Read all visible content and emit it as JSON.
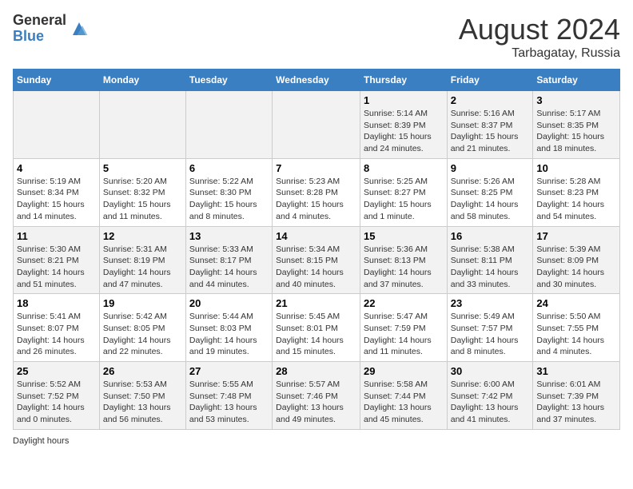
{
  "header": {
    "logo_general": "General",
    "logo_blue": "Blue",
    "month_title": "August 2024",
    "location": "Tarbagatay, Russia"
  },
  "days_of_week": [
    "Sunday",
    "Monday",
    "Tuesday",
    "Wednesday",
    "Thursday",
    "Friday",
    "Saturday"
  ],
  "weeks": [
    [
      {
        "day": "",
        "info": ""
      },
      {
        "day": "",
        "info": ""
      },
      {
        "day": "",
        "info": ""
      },
      {
        "day": "",
        "info": ""
      },
      {
        "day": "1",
        "info": "Sunrise: 5:14 AM\nSunset: 8:39 PM\nDaylight: 15 hours and 24 minutes."
      },
      {
        "day": "2",
        "info": "Sunrise: 5:16 AM\nSunset: 8:37 PM\nDaylight: 15 hours and 21 minutes."
      },
      {
        "day": "3",
        "info": "Sunrise: 5:17 AM\nSunset: 8:35 PM\nDaylight: 15 hours and 18 minutes."
      }
    ],
    [
      {
        "day": "4",
        "info": "Sunrise: 5:19 AM\nSunset: 8:34 PM\nDaylight: 15 hours and 14 minutes."
      },
      {
        "day": "5",
        "info": "Sunrise: 5:20 AM\nSunset: 8:32 PM\nDaylight: 15 hours and 11 minutes."
      },
      {
        "day": "6",
        "info": "Sunrise: 5:22 AM\nSunset: 8:30 PM\nDaylight: 15 hours and 8 minutes."
      },
      {
        "day": "7",
        "info": "Sunrise: 5:23 AM\nSunset: 8:28 PM\nDaylight: 15 hours and 4 minutes."
      },
      {
        "day": "8",
        "info": "Sunrise: 5:25 AM\nSunset: 8:27 PM\nDaylight: 15 hours and 1 minute."
      },
      {
        "day": "9",
        "info": "Sunrise: 5:26 AM\nSunset: 8:25 PM\nDaylight: 14 hours and 58 minutes."
      },
      {
        "day": "10",
        "info": "Sunrise: 5:28 AM\nSunset: 8:23 PM\nDaylight: 14 hours and 54 minutes."
      }
    ],
    [
      {
        "day": "11",
        "info": "Sunrise: 5:30 AM\nSunset: 8:21 PM\nDaylight: 14 hours and 51 minutes."
      },
      {
        "day": "12",
        "info": "Sunrise: 5:31 AM\nSunset: 8:19 PM\nDaylight: 14 hours and 47 minutes."
      },
      {
        "day": "13",
        "info": "Sunrise: 5:33 AM\nSunset: 8:17 PM\nDaylight: 14 hours and 44 minutes."
      },
      {
        "day": "14",
        "info": "Sunrise: 5:34 AM\nSunset: 8:15 PM\nDaylight: 14 hours and 40 minutes."
      },
      {
        "day": "15",
        "info": "Sunrise: 5:36 AM\nSunset: 8:13 PM\nDaylight: 14 hours and 37 minutes."
      },
      {
        "day": "16",
        "info": "Sunrise: 5:38 AM\nSunset: 8:11 PM\nDaylight: 14 hours and 33 minutes."
      },
      {
        "day": "17",
        "info": "Sunrise: 5:39 AM\nSunset: 8:09 PM\nDaylight: 14 hours and 30 minutes."
      }
    ],
    [
      {
        "day": "18",
        "info": "Sunrise: 5:41 AM\nSunset: 8:07 PM\nDaylight: 14 hours and 26 minutes."
      },
      {
        "day": "19",
        "info": "Sunrise: 5:42 AM\nSunset: 8:05 PM\nDaylight: 14 hours and 22 minutes."
      },
      {
        "day": "20",
        "info": "Sunrise: 5:44 AM\nSunset: 8:03 PM\nDaylight: 14 hours and 19 minutes."
      },
      {
        "day": "21",
        "info": "Sunrise: 5:45 AM\nSunset: 8:01 PM\nDaylight: 14 hours and 15 minutes."
      },
      {
        "day": "22",
        "info": "Sunrise: 5:47 AM\nSunset: 7:59 PM\nDaylight: 14 hours and 11 minutes."
      },
      {
        "day": "23",
        "info": "Sunrise: 5:49 AM\nSunset: 7:57 PM\nDaylight: 14 hours and 8 minutes."
      },
      {
        "day": "24",
        "info": "Sunrise: 5:50 AM\nSunset: 7:55 PM\nDaylight: 14 hours and 4 minutes."
      }
    ],
    [
      {
        "day": "25",
        "info": "Sunrise: 5:52 AM\nSunset: 7:52 PM\nDaylight: 14 hours and 0 minutes."
      },
      {
        "day": "26",
        "info": "Sunrise: 5:53 AM\nSunset: 7:50 PM\nDaylight: 13 hours and 56 minutes."
      },
      {
        "day": "27",
        "info": "Sunrise: 5:55 AM\nSunset: 7:48 PM\nDaylight: 13 hours and 53 minutes."
      },
      {
        "day": "28",
        "info": "Sunrise: 5:57 AM\nSunset: 7:46 PM\nDaylight: 13 hours and 49 minutes."
      },
      {
        "day": "29",
        "info": "Sunrise: 5:58 AM\nSunset: 7:44 PM\nDaylight: 13 hours and 45 minutes."
      },
      {
        "day": "30",
        "info": "Sunrise: 6:00 AM\nSunset: 7:42 PM\nDaylight: 13 hours and 41 minutes."
      },
      {
        "day": "31",
        "info": "Sunrise: 6:01 AM\nSunset: 7:39 PM\nDaylight: 13 hours and 37 minutes."
      }
    ]
  ],
  "footer": "Daylight hours"
}
